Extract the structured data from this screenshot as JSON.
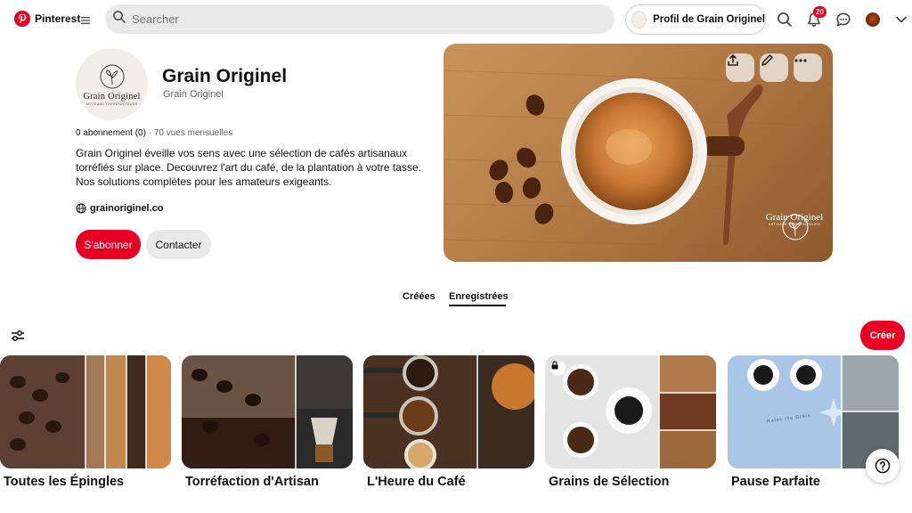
{
  "app": {
    "name": "Pinterest"
  },
  "search": {
    "placeholder": "Searcher"
  },
  "header": {
    "profile_pill_label": "Profil de Grain Originel",
    "notification_count": "20"
  },
  "profile": {
    "logo_word": "Grain Originel",
    "logo_subtitle": "ARTISANS TORRÉFACTEURS",
    "name": "Grain Originel",
    "handle": "Grain Originel",
    "followers": "0 abonnement (0)",
    "monthly_views": "· 70 vues mensuelles",
    "bio_lines": [
      "Grain Originel éveille vos sens avec une sélection de cafés artisanaux",
      "torréfiés sur place.   Decouvrez l'art du café, de la plantation à votre tasse.",
      "Nos solutions complètes    pour les amateurs exigeants."
    ],
    "website": "grainoriginel.co",
    "follow_label": "S'abonner",
    "contact_label": "Contacter"
  },
  "cover": {
    "brand_word": "Grain Originel",
    "brand_subtitle": "ARTISANS TORRÉFACTEURS"
  },
  "tabs": [
    {
      "label": "Créées",
      "active": false
    },
    {
      "label": "Enregistrées",
      "active": true
    }
  ],
  "toolbar": {
    "create_label": "Créer"
  },
  "boards": [
    {
      "title": "Toutes les Épingles",
      "locked": false
    },
    {
      "title": "Torréfaction d'Artisan",
      "locked": false
    },
    {
      "title": "L'Heure du Café",
      "locked": false
    },
    {
      "title": "Grains de Sélection",
      "locked": true
    },
    {
      "title": "Pause Parfaite",
      "locked": false
    }
  ],
  "board5_caption": "Relax the Grain",
  "colors": {
    "brand_red": "#e60023",
    "search_bg": "#e9e9e9",
    "text_primary": "#111111",
    "text_muted": "#5f5f5f"
  },
  "icons": {
    "logo": "pinterest-logo-icon",
    "menu": "menu-icon",
    "search": "search-icon",
    "notifications": "bell-icon",
    "messages": "chat-icon",
    "expand": "chevron-down-icon",
    "share": "share-icon",
    "edit": "pencil-icon",
    "more": "more-icon",
    "website": "globe-icon",
    "filter": "filter-icon",
    "lock": "lock-icon",
    "help": "help-icon"
  }
}
